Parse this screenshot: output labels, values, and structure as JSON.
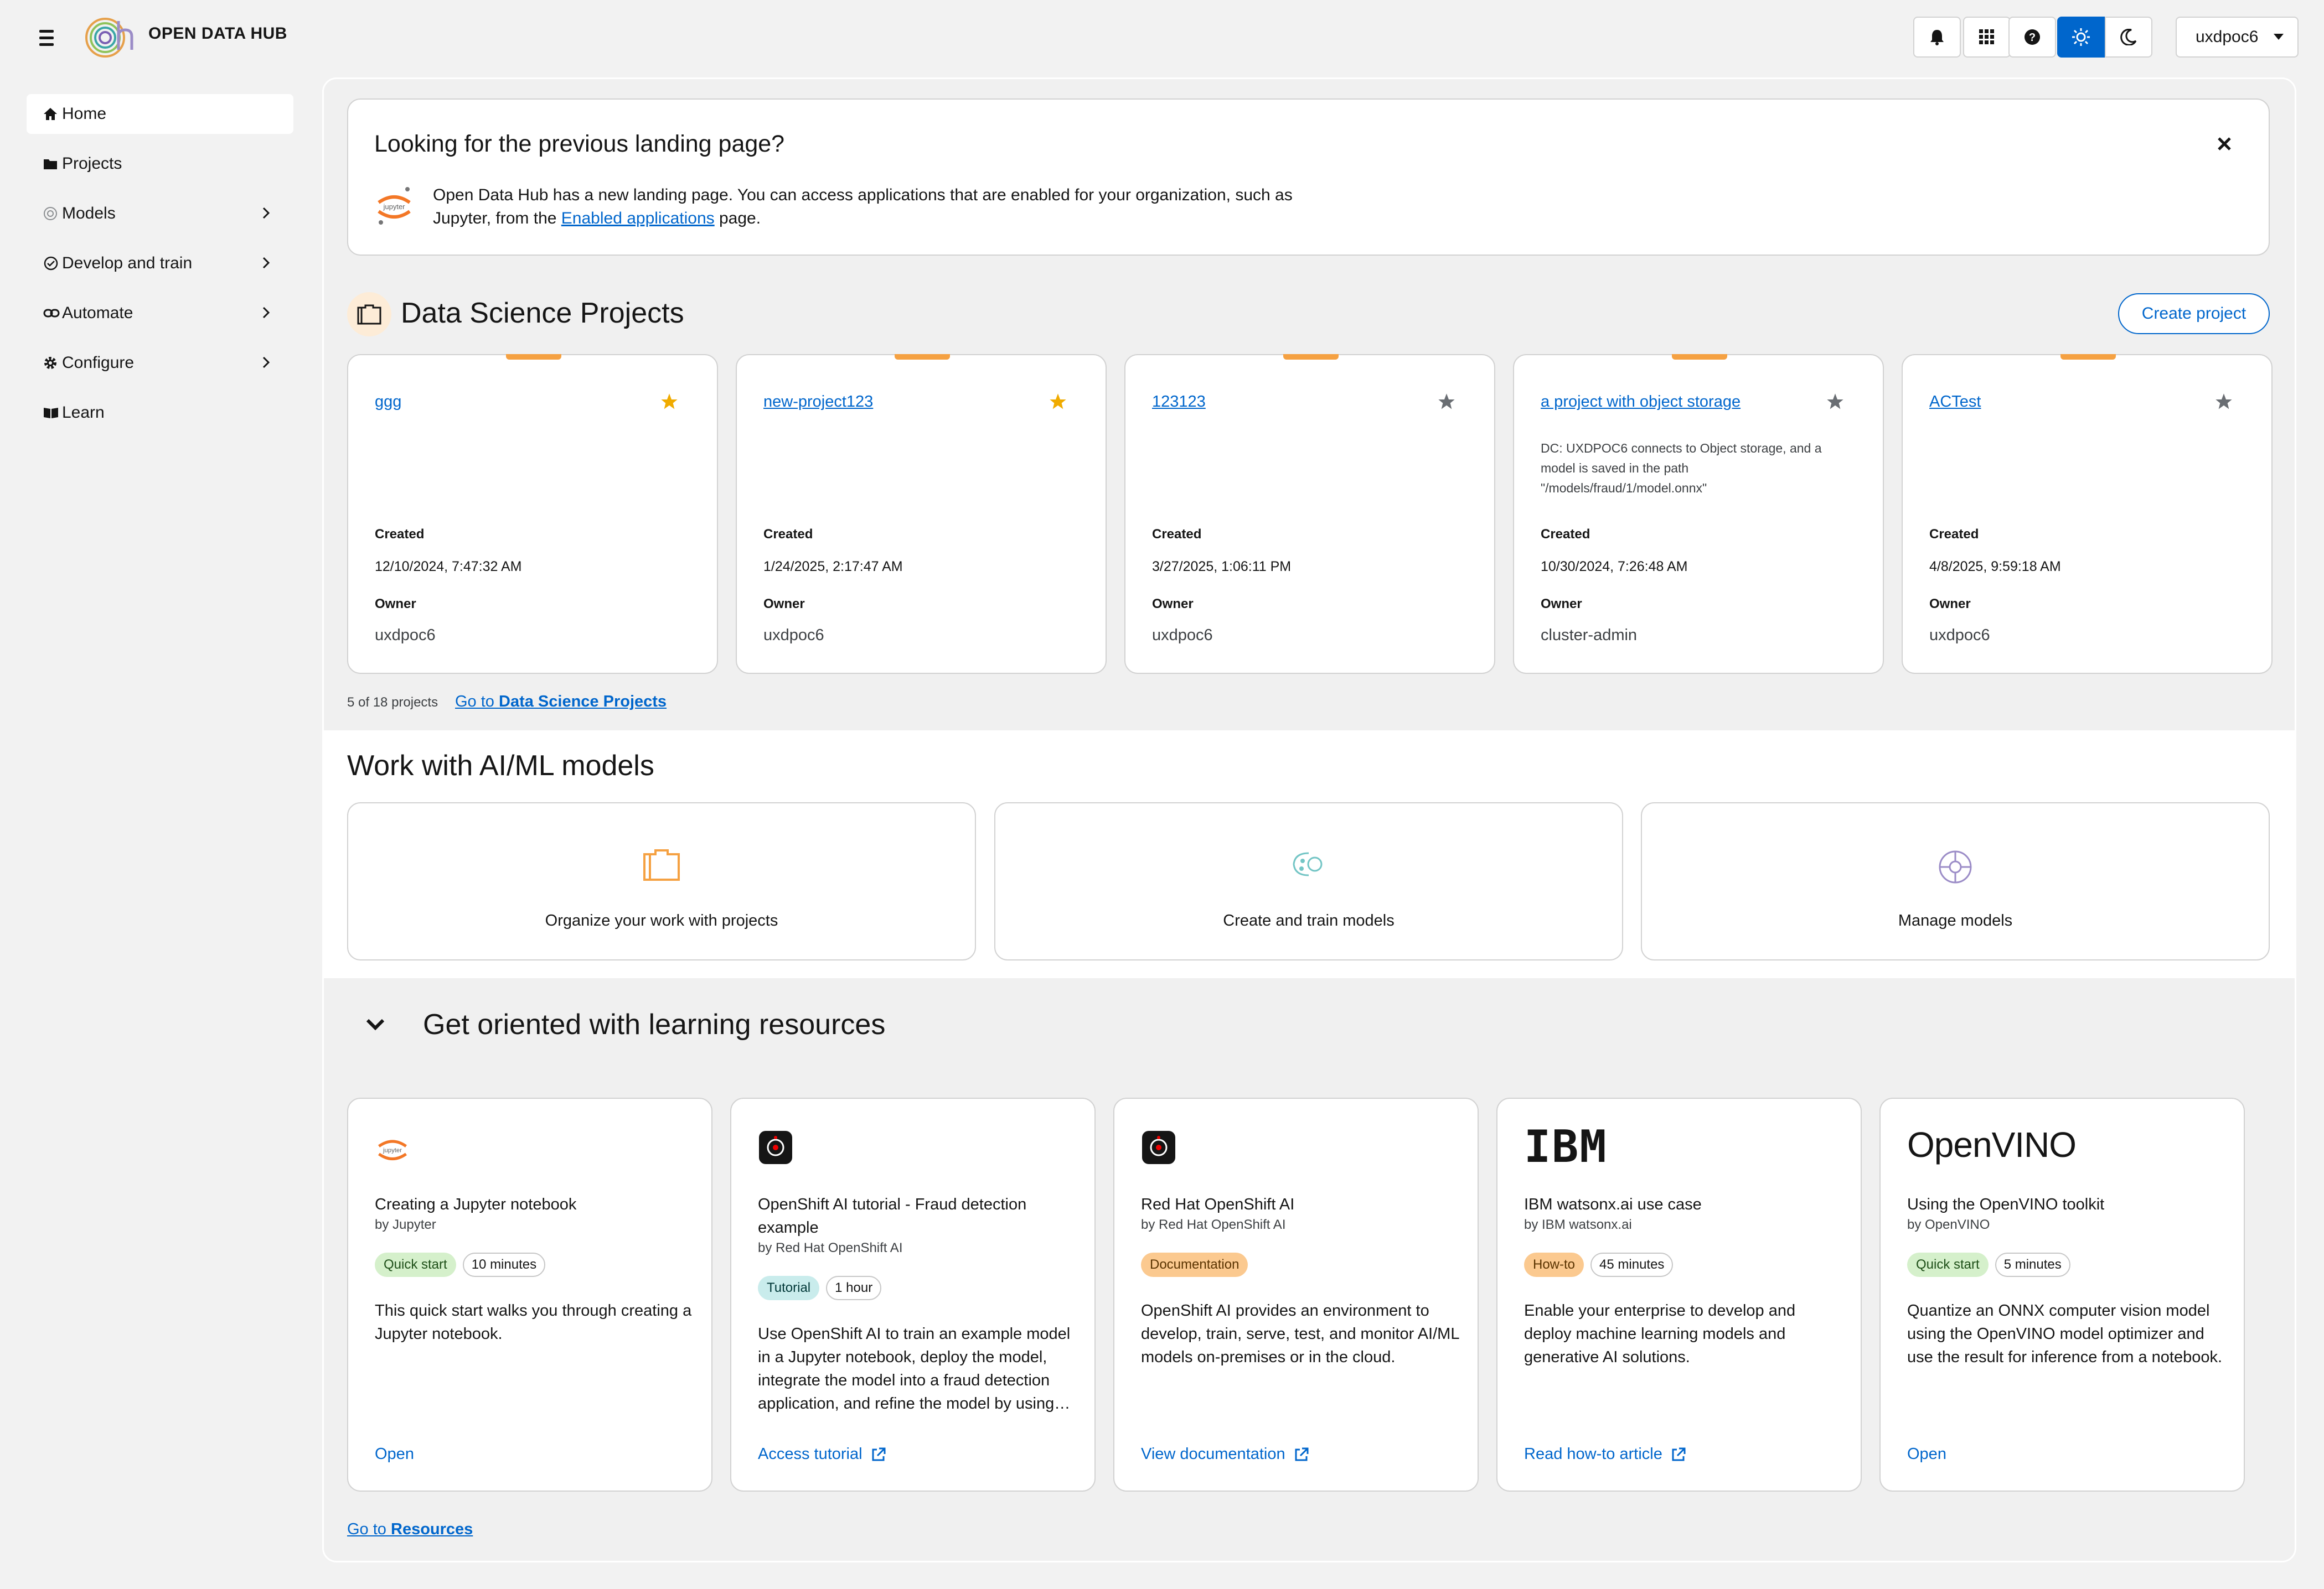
{
  "masthead": {
    "brand": "OPEN DATA HUB",
    "user": "uxdpoc6"
  },
  "sidebar": {
    "items": [
      {
        "label": "Home"
      },
      {
        "label": "Projects"
      },
      {
        "label": "Models"
      },
      {
        "label": "Develop and train"
      },
      {
        "label": "Automate"
      },
      {
        "label": "Configure"
      },
      {
        "label": "Learn"
      }
    ]
  },
  "alert": {
    "title": "Looking for the previous landing page?",
    "text_before": "Open Data Hub has a new landing page. You can access applications that are enabled for your organization, such as Jupyter, from the ",
    "link": "Enabled applications",
    "text_after": " page."
  },
  "dsp": {
    "title": "Data Science Projects",
    "create_label": "Create project",
    "count": "5 of 18 projects",
    "goto_prefix": "Go to ",
    "goto_link": "Data Science Projects",
    "created_label": "Created",
    "owner_label": "Owner",
    "projects": [
      {
        "name": "ggg",
        "starred": true,
        "description": "",
        "created": "12/10/2024, 7:47:32 AM",
        "owner": "uxdpoc6"
      },
      {
        "name": "new-project123",
        "starred": true,
        "description": "",
        "created": "1/24/2025, 2:17:47 AM",
        "owner": "uxdpoc6"
      },
      {
        "name": "123123",
        "starred": false,
        "description": "",
        "created": "3/27/2025, 1:06:11 PM",
        "owner": "uxdpoc6"
      },
      {
        "name": "a project with object storage",
        "starred": false,
        "description": "DC: UXDPOC6 connects to Object storage, and a model is saved in the path \"/models/fraud/1/model.onnx\"",
        "created": "10/30/2024, 7:26:48 AM",
        "owner": "cluster-admin"
      },
      {
        "name": "ACTest",
        "starred": false,
        "description": "",
        "created": "4/8/2025, 9:59:18 AM",
        "owner": "uxdpoc6"
      }
    ]
  },
  "ml": {
    "title": "Work with AI/ML models",
    "cards": [
      {
        "label": "Organize your work with projects",
        "icon": "folder-icon"
      },
      {
        "label": "Create and train models",
        "icon": "model-train-icon"
      },
      {
        "label": "Manage models",
        "icon": "brain-icon"
      }
    ]
  },
  "learning": {
    "title": "Get oriented with learning resources",
    "goto_prefix": "Go to ",
    "goto_link": "Resources",
    "resources": [
      {
        "title": "Creating a Jupyter notebook",
        "by": "by Jupyter",
        "tag": "Quick start",
        "duration": "10 minutes",
        "body": "This quick start walks you through creating a Jupyter notebook.",
        "action": "Open",
        "logo": "jupyter-logo"
      },
      {
        "title": "OpenShift AI tutorial - Fraud detection example",
        "by": "by Red Hat OpenShift AI",
        "tag": "Tutorial",
        "duration": "1 hour",
        "body": "Use OpenShift AI to train an example model in a Jupyter notebook, deploy the model, integrate the model into a fraud detection application, and refine the model by using…",
        "action": "Access tutorial",
        "logo": "openshift-ai-logo"
      },
      {
        "title": "Red Hat OpenShift AI",
        "by": "by Red Hat OpenShift AI",
        "tag": "Documentation",
        "duration": "",
        "body": "OpenShift AI provides an environment to develop, train, serve, test, and monitor AI/ML models on-premises or in the cloud.",
        "action": "View documentation",
        "logo": "openshift-ai-logo"
      },
      {
        "title": "IBM watsonx.ai use case",
        "by": "by IBM watsonx.ai",
        "tag": "How-to",
        "duration": "45 minutes",
        "body": "Enable your enterprise to develop and deploy machine learning models and generative AI solutions.",
        "action": "Read how-to article",
        "logo": "ibm-logo",
        "logo_text": "IBM"
      },
      {
        "title": "Using the OpenVINO toolkit",
        "by": "by OpenVINO",
        "tag": "Quick start",
        "duration": "5 minutes",
        "body": "Quantize an ONNX computer vision model using the OpenVINO model optimizer and use the result for inference from a notebook.",
        "action": "Open",
        "logo": "openvino-logo",
        "logo_text": "OpenVINO"
      }
    ]
  },
  "colors": {
    "link": "#0066cc",
    "star_on": "#f0ab00",
    "star_off": "#6a6e73",
    "accent_orange": "#f5a142",
    "active_toggle": "#0066cc"
  }
}
